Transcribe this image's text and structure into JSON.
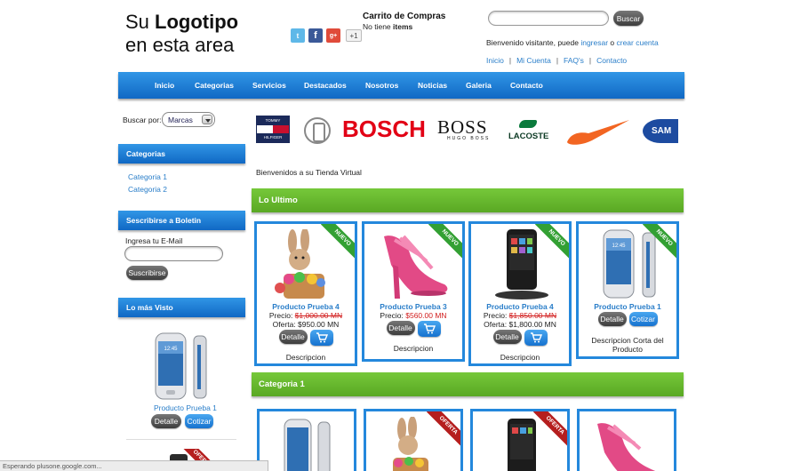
{
  "header": {
    "logo_line1_prefix": "Su ",
    "logo_line1_bold": "Logotipo",
    "logo_line2": "en esta area",
    "cart_title": "Carrito de Compras",
    "cart_status_prefix": "No tiene ",
    "cart_status_bold": "items",
    "search_placeholder": "",
    "search_button": "Buscar",
    "welcome_prefix": "Bienvenido visitante, puede ",
    "login_link": "ingresar",
    "welcome_or": " o ",
    "register_link": "crear cuenta",
    "social": {
      "twitter": "t",
      "facebook": "f",
      "gplus": "g+",
      "plus_one": "+1"
    },
    "top_links": [
      "Inicio",
      "Mi Cuenta",
      "FAQ's",
      "Contacto"
    ],
    "top_link_sep": "|"
  },
  "nav": {
    "items": [
      "Inicio",
      "Categorias",
      "Servicios",
      "Destacados",
      "Nosotros",
      "Noticias",
      "Galeria",
      "Contacto"
    ]
  },
  "sidebar": {
    "search_by_label": "Buscar por:",
    "search_by_value": "Marcas",
    "categories_title": "Categorias",
    "categories": [
      "Categoria 1",
      "Categoria 2"
    ],
    "newsletter_title": "Sescribirse a Boletin",
    "email_label": "Ingresa tu E-Mail",
    "email_value": "",
    "subscribe_button": "Suscribirse",
    "most_viewed_title": "Lo más Visto",
    "most_viewed_product": "Producto Prueba 1",
    "detalle_button": "Detalle",
    "cotizar_button": "Cotizar",
    "offer_ribbon": "OFERTA"
  },
  "brands": {
    "tommy_top": "TOMMY",
    "tommy_bottom": "HILFIGER",
    "bosch": "BOSCH",
    "boss": "BOSS",
    "hugo_boss": "HUGO BOSS",
    "lacoste": "LACOSTE",
    "samsung": "SAM"
  },
  "main": {
    "welcome_text": "Bienvenidos a su Tienda Virtual",
    "latest_title": "Lo Ultimo",
    "category_title": "Categoria 1",
    "latest_products": [
      {
        "name": "Producto Prueba 4",
        "price_label": "Precio: ",
        "price": "$1,000.00 MN",
        "offer_label": "Oferta: ",
        "offer": "$950.00 MN",
        "detalle": "Detalle",
        "description": "Descripcion",
        "ribbon": "NUEVO"
      },
      {
        "name": "Producto Prueba 3",
        "price_label": "Precio: ",
        "price": "$560.00 MN",
        "detalle": "Detalle",
        "description": "Descripcion",
        "ribbon": "NUEVO"
      },
      {
        "name": "Producto Prueba 4",
        "price_label": "Precio: ",
        "price": "$1,850.00 MN",
        "offer_label": "Oferta: ",
        "offer": "$1,800.00 MN",
        "detalle": "Detalle",
        "description": "Descripcion",
        "ribbon": "NUEVO"
      },
      {
        "name": "Producto Prueba 1",
        "detalle": "Detalle",
        "cotizar": "Cotizar",
        "description_line1": "Descripcion Corta del",
        "description_line2": "Producto",
        "ribbon": "NUEVO"
      }
    ],
    "category_ribbons": [
      "",
      "OFERTA",
      "OFERTA",
      ""
    ]
  },
  "statusbar": {
    "text": "Esperando plusone.google.com..."
  },
  "colors": {
    "nav_blue": "#1a7bd6",
    "green_bar": "#66b82e",
    "link_blue": "#2a7ec9",
    "price_red": "#d21d1d"
  }
}
